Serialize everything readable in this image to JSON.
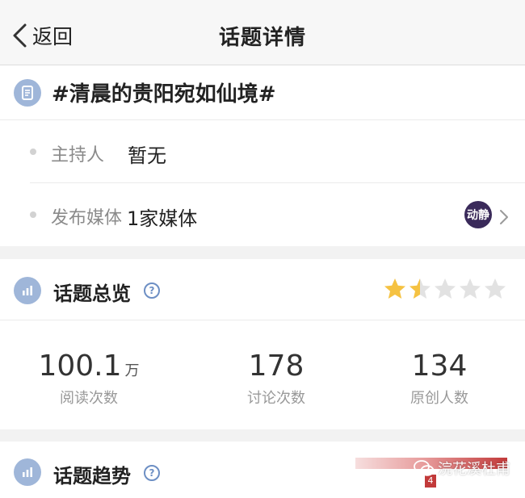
{
  "nav": {
    "back_label": "返回",
    "title": "话题详情"
  },
  "topic": {
    "title": "#清晨的贵阳宛如仙境#",
    "host": {
      "label": "主持人",
      "value": "暂无"
    },
    "media": {
      "label": "发布媒体",
      "value": "1家媒体",
      "avatar_text": "动静"
    }
  },
  "overview": {
    "title": "话题总览",
    "help_glyph": "?",
    "rating": 1.5,
    "rating_max": 5,
    "star_color": "#f5c242",
    "star_empty_color": "#e2e2e2",
    "stats": [
      {
        "value": "100.1",
        "unit": "万",
        "label": "阅读次数"
      },
      {
        "value": "178",
        "unit": "",
        "label": "讨论次数"
      },
      {
        "value": "134",
        "unit": "",
        "label": "原创人数"
      }
    ]
  },
  "trend": {
    "title": "话题趋势",
    "help_glyph": "?",
    "badge": "4",
    "watermark": "浣花溪杜甫"
  },
  "colors": {
    "icon_blue": "#9fb6d9",
    "accent_blue": "#6d8fc4",
    "trend_red": "#c23a3a"
  }
}
